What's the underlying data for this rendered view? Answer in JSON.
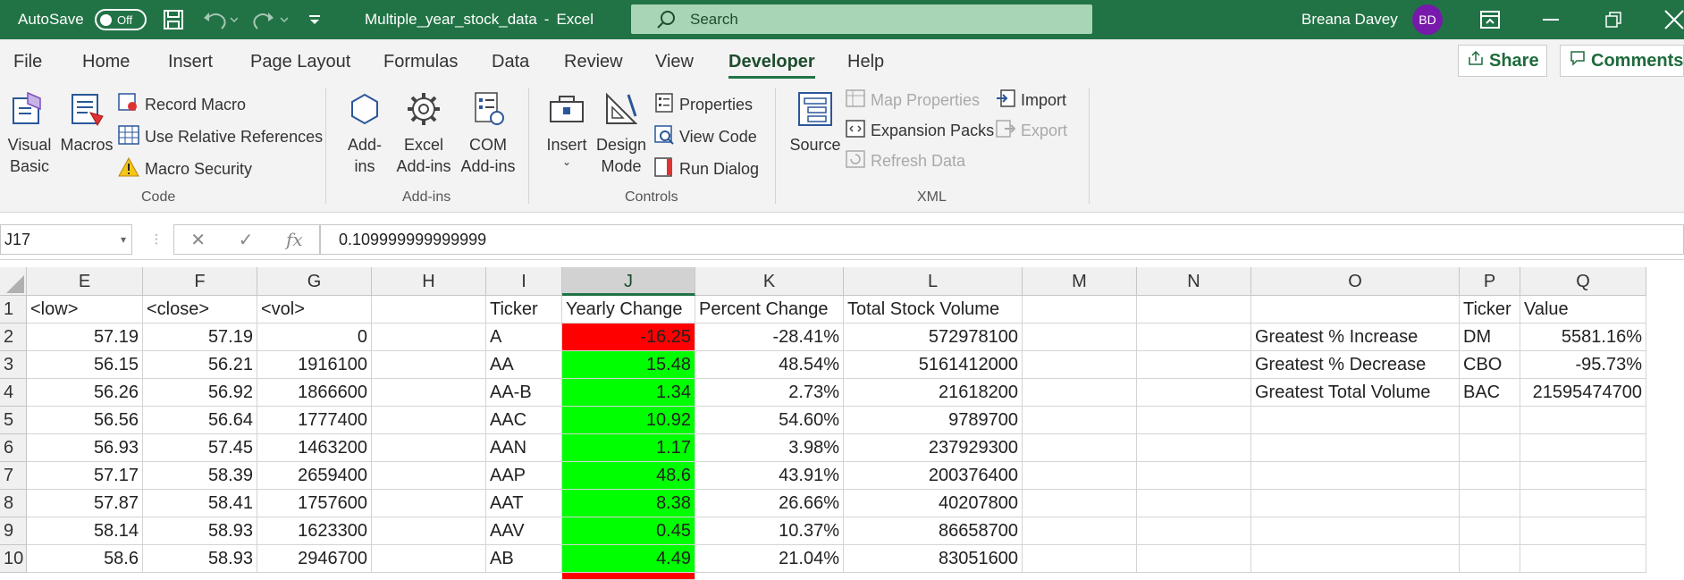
{
  "titlebar": {
    "autosave_label": "AutoSave",
    "autosave_state": "Off",
    "filename": "Multiple_year_stock_data",
    "separator": "-",
    "app_name": "Excel",
    "search_placeholder": "Search",
    "user_name": "Breana Davey",
    "user_initials": "BD",
    "accent_color": "#217346"
  },
  "menu": {
    "items": [
      "File",
      "Home",
      "Insert",
      "Page Layout",
      "Formulas",
      "Data",
      "Review",
      "View",
      "Developer",
      "Help"
    ],
    "active": "Developer",
    "share_label": "Share",
    "comments_label": "Comments"
  },
  "ribbon": {
    "code": {
      "visual_basic": [
        "Visual",
        "Basic"
      ],
      "macros": "Macros",
      "record_macro": "Record Macro",
      "use_relative": "Use Relative References",
      "macro_security": "Macro Security",
      "group_label": "Code"
    },
    "addins": {
      "addins": [
        "Add-",
        "ins"
      ],
      "excel_addins": [
        "Excel",
        "Add-ins"
      ],
      "com_addins": [
        "COM",
        "Add-ins"
      ],
      "group_label": "Add-ins"
    },
    "controls": {
      "insert": "Insert",
      "design_mode": [
        "Design",
        "Mode"
      ],
      "properties": "Properties",
      "view_code": "View Code",
      "run_dialog": "Run Dialog",
      "group_label": "Controls"
    },
    "xml": {
      "source": "Source",
      "map_properties": "Map Properties",
      "expansion_packs": "Expansion Packs",
      "refresh_data": "Refresh Data",
      "import": "Import",
      "export": "Export",
      "group_label": "XML"
    }
  },
  "formula_bar": {
    "name_box": "J17",
    "fx_label": "fx",
    "formula": "0.109999999999999"
  },
  "grid": {
    "columns": [
      "E",
      "F",
      "G",
      "H",
      "I",
      "J",
      "K",
      "L",
      "M",
      "N",
      "O",
      "P",
      "Q"
    ],
    "selected_column": "J",
    "rows": [
      "1",
      "2",
      "3",
      "4",
      "5",
      "6",
      "7",
      "8",
      "9",
      "10"
    ],
    "header_row": {
      "E": "<low>",
      "F": "<close>",
      "G": "<vol>",
      "I": "Ticker",
      "J": "Yearly Change",
      "K": "Percent Change",
      "L": "Total Stock Volume",
      "P": "Ticker",
      "Q": "Value"
    },
    "data": [
      {
        "E": "57.19",
        "F": "57.19",
        "G": "0",
        "I": "A",
        "J": "-16.25",
        "K": "-28.41%",
        "L": "572978100",
        "O": "Greatest % Increase",
        "P": "DM",
        "Q": "5581.16%"
      },
      {
        "E": "56.15",
        "F": "56.21",
        "G": "1916100",
        "I": "AA",
        "J": "15.48",
        "K": "48.54%",
        "L": "5161412000",
        "O": "Greatest % Decrease",
        "P": "CBO",
        "Q": "-95.73%"
      },
      {
        "E": "56.26",
        "F": "56.92",
        "G": "1866600",
        "I": "AA-B",
        "J": "1.34",
        "K": "2.73%",
        "L": "21618200",
        "O": "Greatest Total Volume",
        "P": "BAC",
        "Q": "21595474700"
      },
      {
        "E": "56.56",
        "F": "56.64",
        "G": "1777400",
        "I": "AAC",
        "J": "10.92",
        "K": "54.60%",
        "L": "9789700"
      },
      {
        "E": "56.93",
        "F": "57.45",
        "G": "1463200",
        "I": "AAN",
        "J": "1.17",
        "K": "3.98%",
        "L": "237929300"
      },
      {
        "E": "57.17",
        "F": "58.39",
        "G": "2659400",
        "I": "AAP",
        "J": "48.6",
        "K": "43.91%",
        "L": "200376400"
      },
      {
        "E": "57.87",
        "F": "58.41",
        "G": "1757600",
        "I": "AAT",
        "J": "8.38",
        "K": "26.66%",
        "L": "40207800"
      },
      {
        "E": "58.14",
        "F": "58.93",
        "G": "1623300",
        "I": "AAV",
        "J": "0.45",
        "K": "10.37%",
        "L": "86658700"
      },
      {
        "E": "58.6",
        "F": "58.93",
        "G": "2946700",
        "I": "AB",
        "J": "4.49",
        "K": "21.04%",
        "L": "83051600"
      }
    ],
    "positive_color": "#00ff00",
    "negative_color": "#ff0000"
  }
}
